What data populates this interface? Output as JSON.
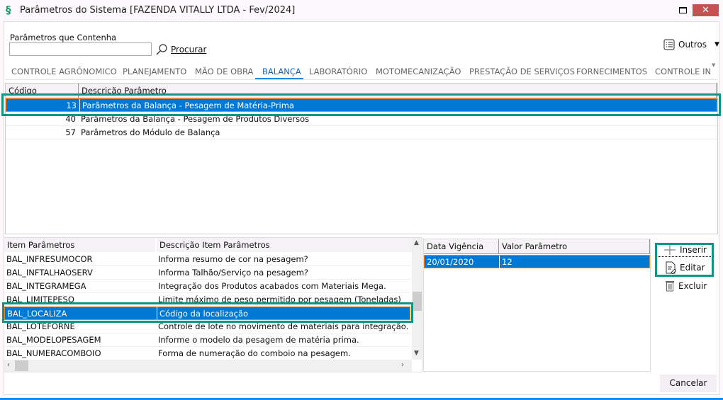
{
  "window": {
    "title": "Parâmetros do Sistema [FAZENDA VITALLY LTDA - Fev/2024]",
    "close": "✕"
  },
  "search": {
    "label": "Parâmetros que Contenha",
    "value": "",
    "button": "Procurar"
  },
  "outros": {
    "label": "Outros"
  },
  "tabs": [
    {
      "label": "CONTROLE AGRÔNOMICO"
    },
    {
      "label": "PLANEJAMENTO"
    },
    {
      "label": "MÃO DE OBRA"
    },
    {
      "label": "BALANÇA",
      "active": true
    },
    {
      "label": "LABORATÓRIO"
    },
    {
      "label": "MOTOMECANIZAÇÃO"
    },
    {
      "label": "PRESTAÇÃO DE SERVIÇOS"
    },
    {
      "label": "FORNECIMENTOS"
    },
    {
      "label": "CONTROLE INI"
    }
  ],
  "params_grid": {
    "headers": [
      "Código",
      "Descrição Parâmetro"
    ],
    "rows": [
      {
        "code": "13",
        "desc": "Parâmetros da Balança - Pesagem de Matéria-Prima",
        "selected": true
      },
      {
        "code": "40",
        "desc": "Parâmetros da Balança - Pesagem de Produtos Diversos"
      },
      {
        "code": "57",
        "desc": "Parâmetros do Módulo de Balança"
      }
    ]
  },
  "items_grid": {
    "headers": [
      "Item Parâmetros",
      "Descrição Item Parâmetros"
    ],
    "rows": [
      {
        "item": "BAL_INFRESUMOCOR",
        "desc": "Informa resumo de cor na pesagem?"
      },
      {
        "item": "BAL_INFTALHAOSERV",
        "desc": "Informa Talhão/Serviço na pesagem?"
      },
      {
        "item": "BAL_INTEGRAMEGA",
        "desc": "Integração dos Produtos acabados com Materiais Mega."
      },
      {
        "item": "BAL_LIMITEPESO",
        "desc": "Limite máximo de peso permitido por pesagem (Toneladas)"
      },
      {
        "item": "BAL_LOCALIZA",
        "desc": "Código da localização",
        "selected": true
      },
      {
        "item": "BAL_LOTEFORNE",
        "desc": "Controle de lote no movimento de materiais para integração."
      },
      {
        "item": "BAL_MODELOPESAGEM",
        "desc": "Informe o modelo da pesagem de matéria prima."
      },
      {
        "item": "BAL_NUMERACOMBOIO",
        "desc": "Forma de numeração do comboio na pesagem."
      }
    ]
  },
  "values_grid": {
    "headers": [
      "Data Vigência",
      "Valor Parâmetro"
    ],
    "rows": [
      {
        "date": "20/01/2020",
        "value": "12",
        "selected": true
      }
    ]
  },
  "actions": {
    "insert": "Inserir",
    "edit": "Editar",
    "delete": "Excluir",
    "cancel": "Cancelar"
  },
  "colors": {
    "selection": "#0078d4",
    "highlight": "#0f9486",
    "close": "#c75050",
    "tab_active": "#1565c0"
  }
}
